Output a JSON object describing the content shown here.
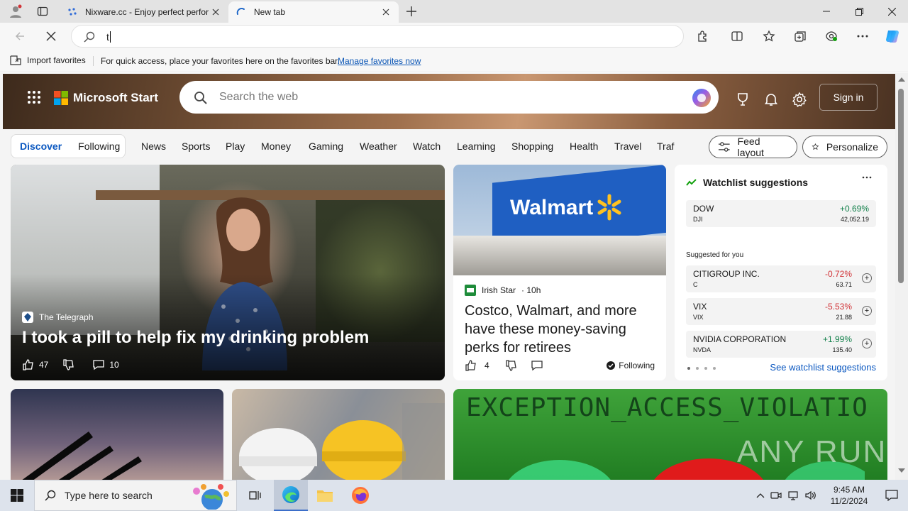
{
  "browser": {
    "tabs": [
      {
        "title": "Nixware.cc - Enjoy perfect perfor",
        "favicon": "nixware-favicon"
      },
      {
        "title": "New tab",
        "favicon": "loading-spinner"
      }
    ],
    "address_value": "t",
    "favorites": {
      "import_label": "Import favorites",
      "hint": "For quick access, place your favorites here on the favorites bar.",
      "manage_link": "Manage favorites now"
    }
  },
  "msn": {
    "brand": "Microsoft Start",
    "search_placeholder": "Search the web",
    "signin_label": "Sign in",
    "tabs": {
      "discover": "Discover",
      "following": "Following"
    },
    "nav_items": [
      "News",
      "Sports",
      "Play",
      "Money",
      "Gaming",
      "Weather",
      "Watch",
      "Learning",
      "Shopping",
      "Health",
      "Travel",
      "Traf"
    ],
    "feed_layout_label": "Feed layout",
    "personalize_label": "Personalize",
    "main_story": {
      "source": "The Telegraph",
      "headline": "I took a pill to help fix my drinking problem",
      "likes": "47",
      "comments": "10"
    },
    "side_story": {
      "source": "Irish Star",
      "age": "· 10h",
      "sign_text": "Walmart",
      "headline": "Costco, Walmart, and more have these money-saving perks for retirees",
      "likes": "4",
      "following_label": "Following"
    },
    "watchlist": {
      "title": "Watchlist suggestions",
      "top": {
        "name": "DOW",
        "symbol": "DJI",
        "change": "+0.69%",
        "price": "42,052.19",
        "direction": "up"
      },
      "suggested_label": "Suggested for you",
      "items": [
        {
          "name": "CITIGROUP INC.",
          "symbol": "C",
          "change": "-0.72%",
          "price": "63.71",
          "direction": "down"
        },
        {
          "name": "VIX",
          "symbol": "VIX",
          "change": "-5.53%",
          "price": "21.88",
          "direction": "down"
        },
        {
          "name": "NVIDIA CORPORATION",
          "symbol": "NVDA",
          "change": "+1.99%",
          "price": "135.40",
          "direction": "up"
        }
      ],
      "see_all": "See watchlist suggestions"
    },
    "bottom_card_text": "EXCEPTION_ACCESS_VIOLATIO",
    "watermark": "ANY RUN"
  },
  "taskbar": {
    "search_placeholder": "Type here to search",
    "time": "9:45 AM",
    "date": "11/2/2024"
  },
  "colors": {
    "up": "#13804b",
    "down": "#d13438",
    "link": "#0a57c0",
    "accent": "#0078d4"
  }
}
